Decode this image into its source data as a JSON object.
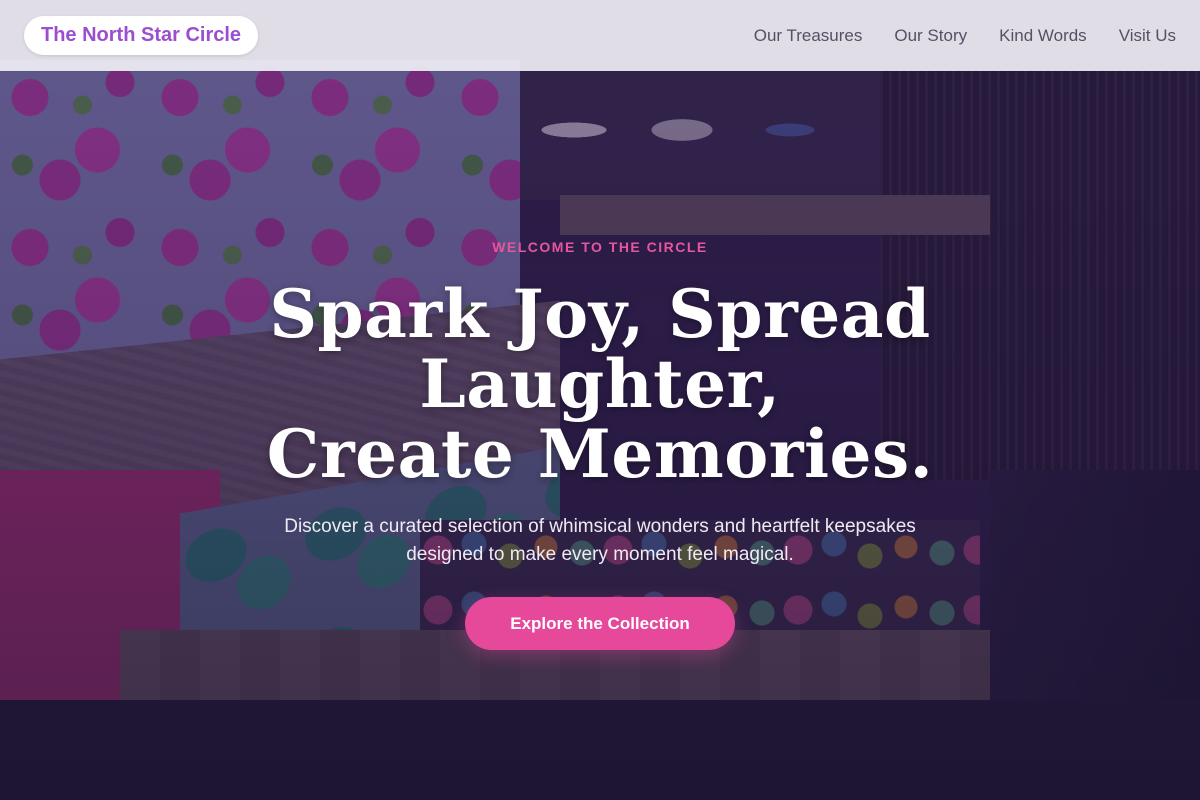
{
  "nav": {
    "brand": "The North Star Circle",
    "links": [
      "Our Treasures",
      "Our Story",
      "Kind Words",
      "Visit Us"
    ]
  },
  "hero": {
    "eyebrow": "Welcome to the Circle",
    "headline_line1": "Spark Joy, Spread Laughter,",
    "headline_line2": "Create Memories.",
    "subtext": "Discover a curated selection of whimsical wonders and heartfelt keepsakes designed to make every moment feel magical.",
    "cta": "Explore the Collection",
    "background_image": "market-stall-souvenirs-photo"
  },
  "colors": {
    "accent": "#e6489a",
    "brand": "#9b4fd0",
    "eyebrow": "#e5569f"
  }
}
